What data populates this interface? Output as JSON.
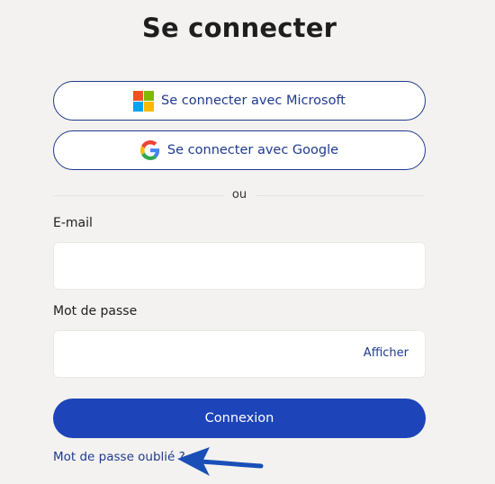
{
  "page": {
    "title": "Se connecter"
  },
  "sso": {
    "microsoft_label": "Se connecter avec Microsoft",
    "google_label": "Se connecter avec Google",
    "microsoft_icon": "microsoft-logo-icon",
    "google_icon": "google-logo-icon"
  },
  "divider": {
    "text": "ou"
  },
  "form": {
    "email_label": "E-mail",
    "email_value": "",
    "password_label": "Mot de passe",
    "password_value": "",
    "show_password_label": "Afficher",
    "submit_label": "Connexion",
    "forgot_label": "Mot de passe oublié ?"
  },
  "annotation": {
    "icon": "blue-arrow-icon",
    "color": "#1a4fb8"
  },
  "colors": {
    "background": "#f3f2f0",
    "primary": "#1d44b8",
    "outline": "#1f3a8f",
    "ms_red": "#f25022",
    "ms_green": "#7fba00",
    "ms_blue": "#00a4ef",
    "ms_yellow": "#ffb900"
  }
}
